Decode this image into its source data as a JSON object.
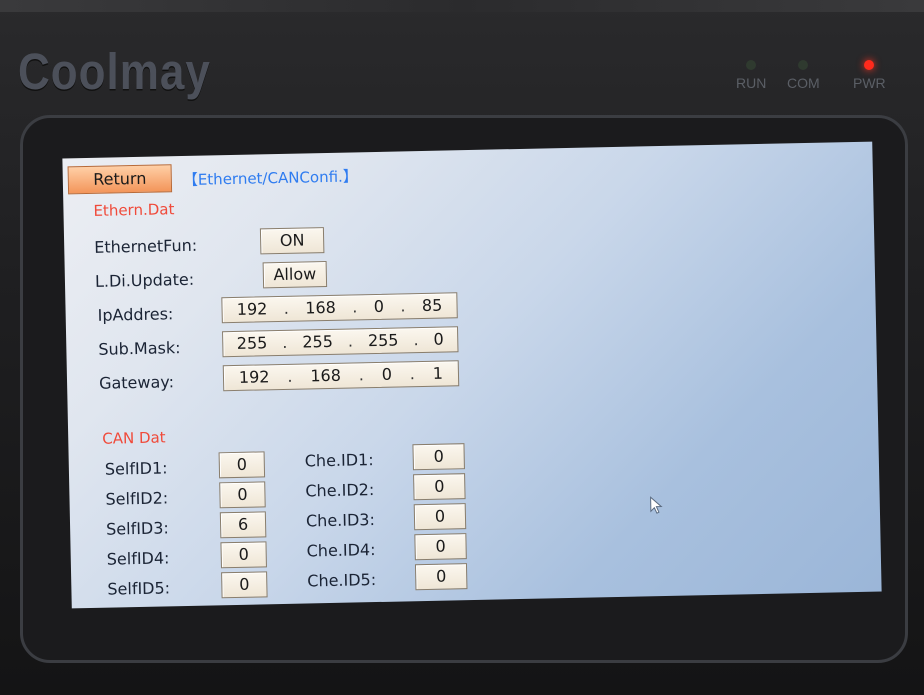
{
  "device": {
    "brand": "Coolmay",
    "leds": [
      {
        "label": "RUN",
        "state": "off",
        "color": "#2f3a2f"
      },
      {
        "label": "COM",
        "state": "off",
        "color": "#2f3a2f"
      },
      {
        "label": "PWR",
        "state": "on",
        "color": "#ff2a1c"
      }
    ]
  },
  "screen": {
    "return_label": "Return",
    "title": "【Ethernet/CANConfi.】",
    "ethernet": {
      "section_label": "Ethern.Dat",
      "ethernet_fun_label": "EthernetFun:",
      "ethernet_fun_value": "ON",
      "ldi_update_label": "L.Di.Update:",
      "ldi_update_value": "Allow",
      "ip_label": "IpAddres:",
      "ip": [
        "192",
        "168",
        "0",
        "85"
      ],
      "mask_label": "Sub.Mask:",
      "mask": [
        "255",
        "255",
        "255",
        "0"
      ],
      "gateway_label": "Gateway:",
      "gateway": [
        "192",
        "168",
        "0",
        "1"
      ],
      "separator": "."
    },
    "can": {
      "section_label": "CAN Dat",
      "self_ids": [
        {
          "label": "SelfID1:",
          "value": "0"
        },
        {
          "label": "SelfID2:",
          "value": "0"
        },
        {
          "label": "SelfID3:",
          "value": "6"
        },
        {
          "label": "SelfID4:",
          "value": "0"
        },
        {
          "label": "SelfID5:",
          "value": "0"
        }
      ],
      "che_ids": [
        {
          "label": "Che.ID1:",
          "value": "0"
        },
        {
          "label": "Che.ID2:",
          "value": "0"
        },
        {
          "label": "Che.ID3:",
          "value": "0"
        },
        {
          "label": "Che.ID4:",
          "value": "0"
        },
        {
          "label": "Che.ID5:",
          "value": "0"
        }
      ]
    }
  },
  "colors": {
    "return_button": "#f3955a",
    "title_text": "#2f7cf0",
    "section_text": "#f04a3a",
    "field_bg": "#fbf7ef"
  },
  "icons": {
    "cursor": "mouse-pointer-icon"
  }
}
